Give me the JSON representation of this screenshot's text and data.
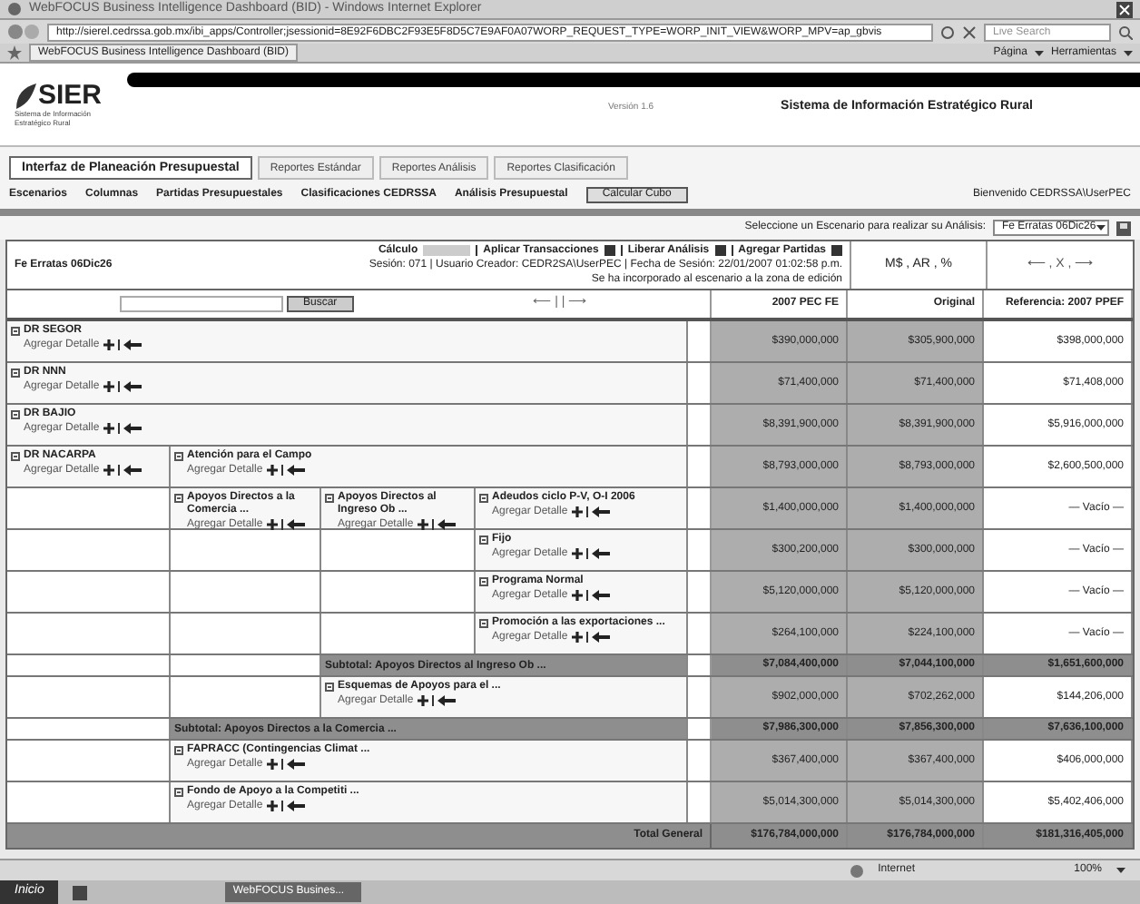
{
  "browser": {
    "title": "WebFOCUS Business Intelligence Dashboard (BID) - Windows Internet Explorer",
    "address": "http://sierel.cedrssa.gob.mx/ibi_apps/Controller;jsessionid=8E92F6DBC2F93E5F8D5C7E9AF0A07WORP_REQUEST_TYPE=WORP_INIT_VIEW&WORP_MPV=ap_gbvis",
    "search_placeholder": "Live Search",
    "tab": "WebFOCUS Business Intelligence Dashboard (BID)",
    "tools": [
      "Página",
      "Herramientas"
    ]
  },
  "header": {
    "logo": "SIER",
    "logo_caption": "Sistema de Información Estratégico Rural",
    "version": "Versión 1.6",
    "system_title": "Sistema de Información Estratégico Rural"
  },
  "tabs": [
    {
      "label": "Interfaz de Planeación Presupuestal",
      "selected": true
    },
    {
      "label": "Reportes Estándar",
      "selected": false
    },
    {
      "label": "Reportes Análisis",
      "selected": false
    },
    {
      "label": "Reportes Clasificación",
      "selected": false
    }
  ],
  "menu": [
    "Escenarios",
    "Columnas",
    "Partidas Presupuestales",
    "Clasificaciones CEDRSSA",
    "Análisis Presupuestal"
  ],
  "calc_button": "Calcular Cubo",
  "welcome": "Bienvenido CEDRSSA\\UserPEC",
  "scenario": {
    "label": "Seleccione un Escenario para realizar su Análisis:",
    "value": "Fe Erratas 06Dic26"
  },
  "session": {
    "scenario_name": "Fe Erratas 06Dic26",
    "actions": [
      "Cálculo",
      "Aplicar Transacciones",
      "Liberar Análisis",
      "Agregar Partidas"
    ],
    "info": "Sesión: 071 | Usuario Creador: CEDR2SA\\UserPEC | Fecha de Sesión: 22/01/2007 01:02:58 p.m.",
    "message": "Se ha incorporado al escenario a la zona de edición",
    "units": "M$ , AR , %",
    "nav": "⟵ , X , ⟶",
    "column_nav": "⟵ | | ⟶"
  },
  "search_button": "Buscar",
  "columns": [
    "2007 PEC FE",
    "Original",
    "Referencia: 2007 PPEF"
  ],
  "rows": [
    {
      "label": "DR SEGOR",
      "action": "Agregar Detalle",
      "values": [
        "$390,000,000",
        "$305,900,000",
        "$398,000,000"
      ]
    },
    {
      "label": "DR NNN",
      "action": "Agregar Detalle",
      "values": [
        "$71,400,000",
        "$71,400,000",
        "$71,408,000"
      ]
    },
    {
      "label": "DR BAJIO",
      "action": "Agregar Detalle",
      "values": [
        "$8,391,900,000",
        "$8,391,900,000",
        "$5,916,000,000"
      ]
    },
    {
      "label": "DR NACARPA",
      "action": "Agregar Detalle",
      "children": [
        {
          "label": "Atención para el Campo",
          "action": "Agregar Detalle",
          "values": [
            "$8,793,000,000",
            "$8,793,000,000",
            "$2,600,500,000"
          ],
          "children": [
            {
              "label": "Apoyos Directos a la Comercia ...",
              "action": "Agregar Detalle",
              "children": [
                {
                  "label": "Apoyos Directos al Ingreso Ob ...",
                  "action": "Agregar Detalle",
                  "children": [
                    {
                      "label": "Adeudos ciclo P-V, O-I 2006",
                      "action": "Agregar Detalle",
                      "values": [
                        "$1,400,000,000",
                        "$1,400,000,000",
                        "— Vacío —"
                      ]
                    },
                    {
                      "label": "Fijo",
                      "action": "Agregar Detalle",
                      "values": [
                        "$300,200,000",
                        "$300,000,000",
                        "— Vacío —"
                      ]
                    },
                    {
                      "label": "Programa Normal",
                      "action": "Agregar Detalle",
                      "values": [
                        "$5,120,000,000",
                        "$5,120,000,000",
                        "— Vacío —"
                      ]
                    },
                    {
                      "label": "Promoción a las exportaciones ...",
                      "action": "Agregar Detalle",
                      "values": [
                        "$264,100,000",
                        "$224,100,000",
                        "— Vacío —"
                      ]
                    }
                  ]
                },
                {
                  "kind": "subtotal",
                  "label": "Subtotal: Apoyos Directos al Ingreso Ob ...",
                  "values": [
                    "$7,084,400,000",
                    "$7,044,100,000",
                    "$1,651,600,000"
                  ]
                },
                {
                  "label": "Esquemas de Apoyos para el ...",
                  "action": "Agregar Detalle",
                  "values": [
                    "$902,000,000",
                    "$702,262,000",
                    "$144,206,000"
                  ]
                }
              ]
            },
            {
              "kind": "subtotal",
              "label": "Subtotal: Apoyos Directos a la Comercia ...",
              "values": [
                "$7,986,300,000",
                "$7,856,300,000",
                "$7,636,100,000"
              ]
            },
            {
              "label": "FAPRACC (Contingencias Climat ...",
              "action": "Agregar Detalle",
              "values": [
                "$367,400,000",
                "$367,400,000",
                "$406,000,000"
              ]
            },
            {
              "label": "Fondo de Apoyo a la Competiti ...",
              "action": "Agregar Detalle",
              "values": [
                "$5,014,300,000",
                "$5,014,300,000",
                "$5,402,406,000"
              ]
            }
          ]
        }
      ]
    }
  ],
  "total": {
    "label": "Total General",
    "values": [
      "$176,784,000,000",
      "$176,784,000,000",
      "$181,316,405,000"
    ]
  },
  "status_bar": {
    "zone": "Internet",
    "zoom": "100%"
  },
  "taskbar": {
    "start": "Inicio",
    "window": "WebFOCUS Busines..."
  }
}
